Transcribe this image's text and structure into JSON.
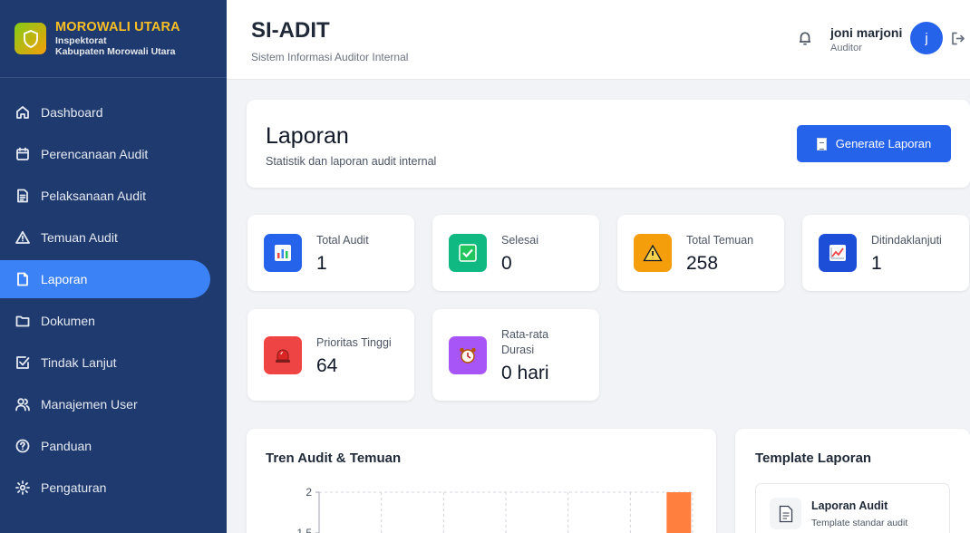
{
  "brand": {
    "title": "MOROWALI UTARA",
    "sub1": "Inspektorat",
    "sub2": "Kabupaten Morowali Utara"
  },
  "sidebar": {
    "items": [
      {
        "label": "Dashboard",
        "icon": "home-icon"
      },
      {
        "label": "Perencanaan Audit",
        "icon": "calendar-icon"
      },
      {
        "label": "Pelaksanaan Audit",
        "icon": "file-text-icon"
      },
      {
        "label": "Temuan Audit",
        "icon": "alert-triangle-icon"
      },
      {
        "label": "Laporan",
        "icon": "file-icon",
        "active": true
      },
      {
        "label": "Dokumen",
        "icon": "folder-icon"
      },
      {
        "label": "Tindak Lanjut",
        "icon": "check-square-icon"
      },
      {
        "label": "Manajemen User",
        "icon": "users-icon"
      },
      {
        "label": "Panduan",
        "icon": "help-circle-icon"
      },
      {
        "label": "Pengaturan",
        "icon": "settings-icon"
      }
    ]
  },
  "header": {
    "title": "SI-ADIT",
    "subtitle": "Sistem Informasi Auditor Internal",
    "user_name": "joni marjoni",
    "user_role": "Auditor",
    "avatar_letter": "j"
  },
  "page": {
    "title": "Laporan",
    "subtitle": "Statistik dan laporan audit internal",
    "generate_label": "Generate Laporan"
  },
  "stats": [
    {
      "label": "Total Audit",
      "value": "1",
      "icon": "bar-chart-icon",
      "color": "#2563eb"
    },
    {
      "label": "Selesai",
      "value": "0",
      "icon": "check-box-icon",
      "color": "#10b981"
    },
    {
      "label": "Total Temuan",
      "value": "258",
      "icon": "warning-icon",
      "color": "#f59e0b"
    },
    {
      "label": "Ditindaklanjuti",
      "value": "1",
      "icon": "trend-chart-icon",
      "color": "#1d4ed8"
    },
    {
      "label": "Prioritas Tinggi",
      "value": "64",
      "icon": "siren-icon",
      "color": "#ef4444"
    },
    {
      "label": "Rata-rata Durasi",
      "value": "0 hari",
      "icon": "alarm-clock-icon",
      "color": "#a855f7"
    }
  ],
  "chart": {
    "title": "Tren Audit & Temuan"
  },
  "chart_data": {
    "type": "bar",
    "y_ticks": [
      "2",
      "1.5"
    ],
    "ylim": [
      0,
      2
    ],
    "bar_color": "#ff7f3f"
  },
  "templates": {
    "title": "Template Laporan",
    "items": [
      {
        "name": "Laporan Audit",
        "desc": "Template standar audit"
      }
    ]
  }
}
